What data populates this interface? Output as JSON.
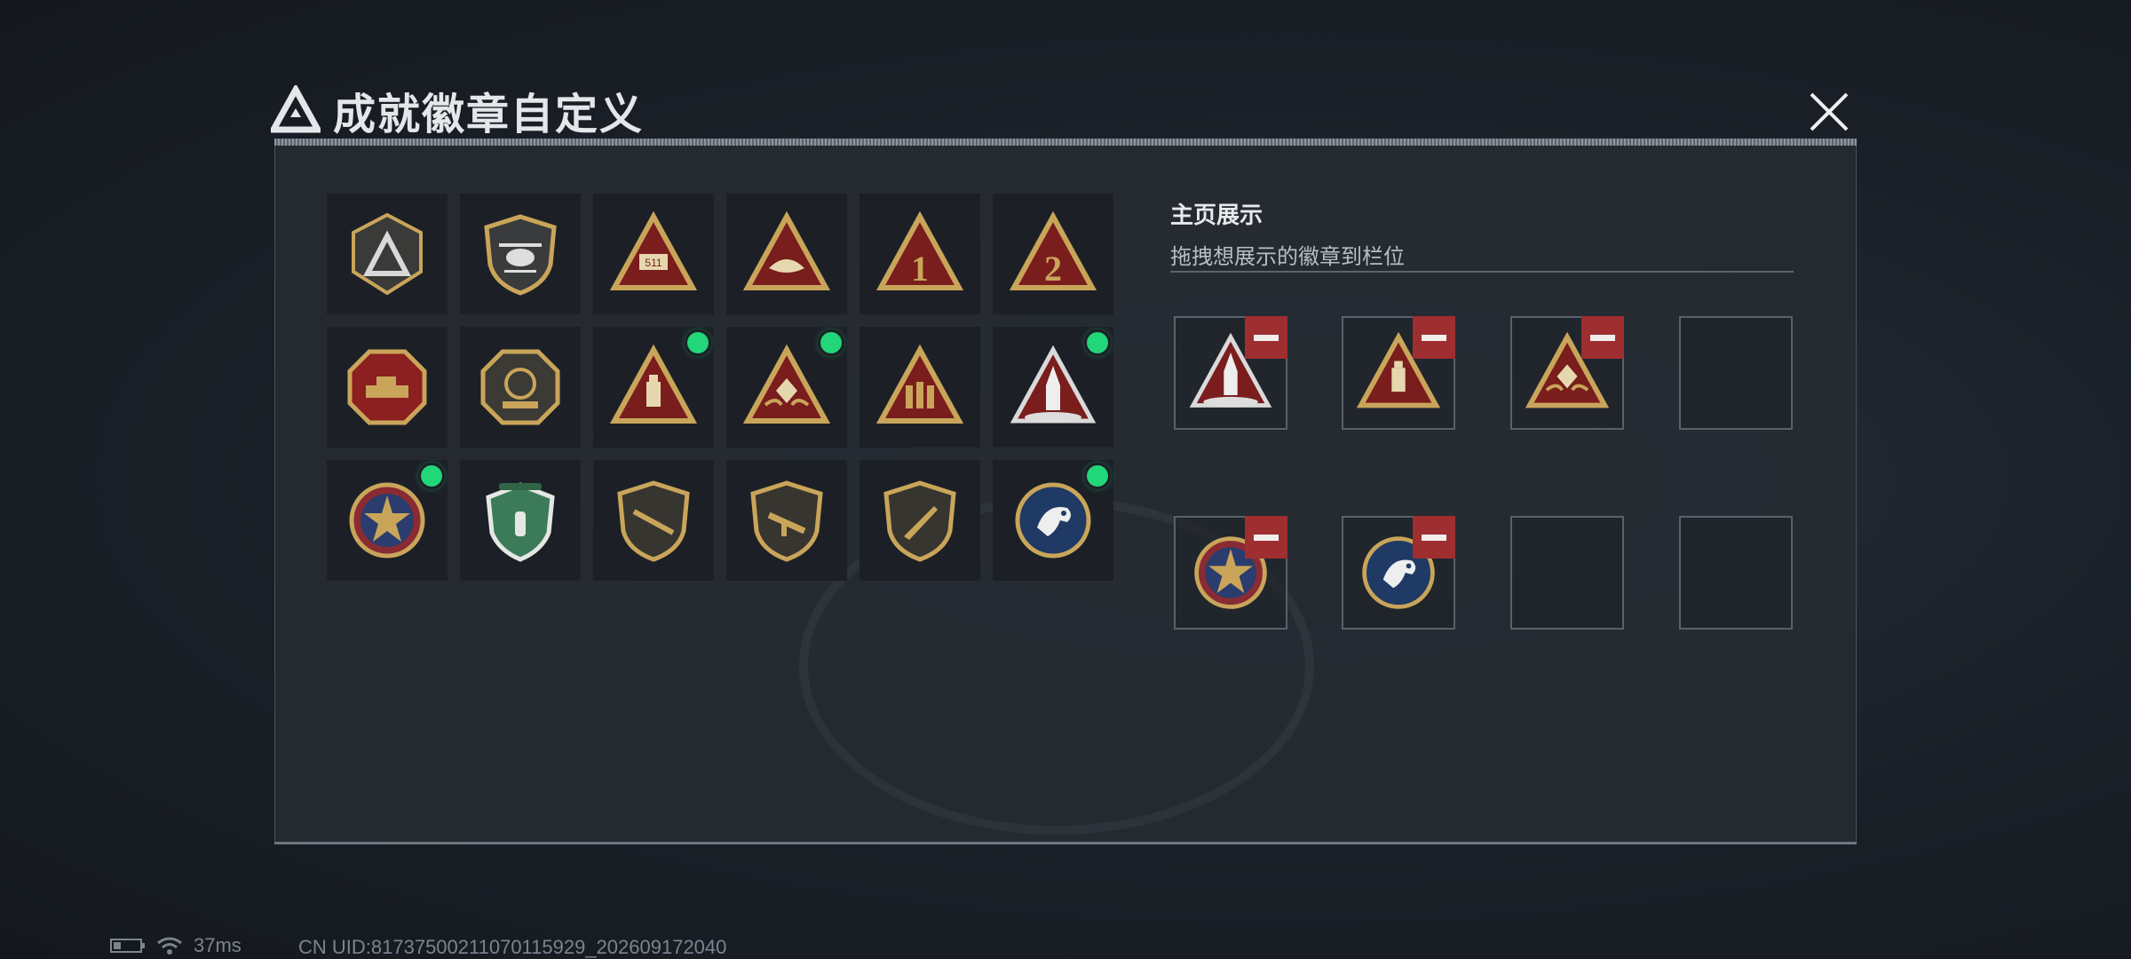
{
  "header": {
    "title": "成就徽章自定义",
    "close_icon": "close-icon"
  },
  "display": {
    "title": "主页展示",
    "subtitle": "拖拽想展示的徽章到栏位"
  },
  "badges": [
    {
      "icon": "delta-shield-badge",
      "new": false
    },
    {
      "icon": "helicopter-shield-badge",
      "new": false
    },
    {
      "icon": "s11-tank-triangle-badge",
      "new": false
    },
    {
      "icon": "hands-triangle-badge",
      "new": false
    },
    {
      "icon": "number-1-triangle-badge",
      "new": false
    },
    {
      "icon": "number-2-triangle-badge",
      "new": false
    },
    {
      "icon": "tank-octagon-badge",
      "new": false
    },
    {
      "icon": "delta-force-2026-badge",
      "new": false
    },
    {
      "icon": "usb-triangle-badge",
      "new": true
    },
    {
      "icon": "dice-hands-triangle-badge",
      "new": true
    },
    {
      "icon": "soldiers-triangle-badge",
      "new": false
    },
    {
      "icon": "rocket-triangle-badge",
      "new": true
    },
    {
      "icon": "star-medal-badge",
      "new": true
    },
    {
      "icon": "green-shield-badge",
      "new": false
    },
    {
      "icon": "rifle-shield-badge",
      "new": false
    },
    {
      "icon": "smg-shield-badge",
      "new": false
    },
    {
      "icon": "knife-shield-badge",
      "new": false
    },
    {
      "icon": "eagle-roundel-badge",
      "new": true
    }
  ],
  "slots": [
    {
      "icon": "rocket-triangle-badge",
      "filled": true
    },
    {
      "icon": "usb-triangle-badge",
      "filled": true
    },
    {
      "icon": "dice-hands-triangle-badge",
      "filled": true
    },
    {
      "icon": "",
      "filled": false
    },
    {
      "icon": "star-medal-badge",
      "filled": true
    },
    {
      "icon": "eagle-roundel-badge",
      "filled": true
    },
    {
      "icon": "",
      "filled": false
    },
    {
      "icon": "",
      "filled": false
    }
  ],
  "status": {
    "ping": "37ms",
    "uid": "CN UID:81737500211070115929_202609172040"
  },
  "colors": {
    "accent_new": "#22d67a",
    "remove": "#9e2e2f",
    "gold": "#c9a55a",
    "crimson": "#7a1d1d"
  }
}
